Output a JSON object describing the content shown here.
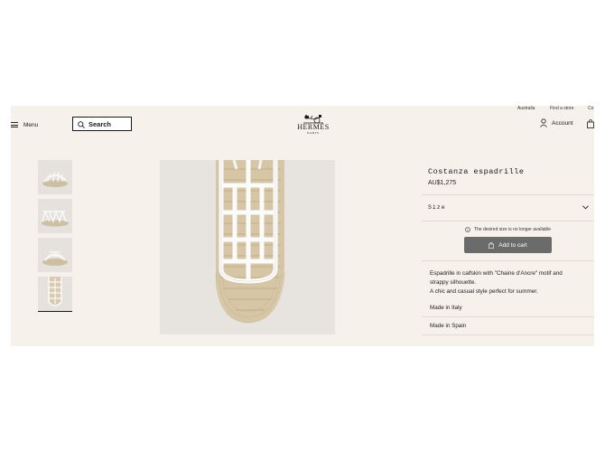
{
  "utility_bar": {
    "country": "Australia",
    "find_store": "Find a store",
    "contact": "Co"
  },
  "header": {
    "menu_label": "Menu",
    "search_label": "Search",
    "logo_name": "HERMÈS",
    "logo_city": "PARIS",
    "account_label": "Account"
  },
  "product": {
    "name": "Costanza espadrille",
    "price": "AU$1,275",
    "size_label": "Size",
    "size_notice": "The desired size is no longer available",
    "add_to_cart": "Add to cart",
    "description_1": "Espadrille in calfskin with \"Chaine d'Ancre\" motif and",
    "description_2": "strappy silhouette.",
    "description_3": "A chic and casual style perfect for summer.",
    "made_in_1": "Made in Italy",
    "made_in_2": "Made in Spain"
  },
  "gallery": {
    "thumbnail_count": 4,
    "active_index": 3
  },
  "colors": {
    "page_bg": "#f6f1eb",
    "button_bg": "#6b6b6b",
    "image_bg": "#e7e4e0"
  }
}
